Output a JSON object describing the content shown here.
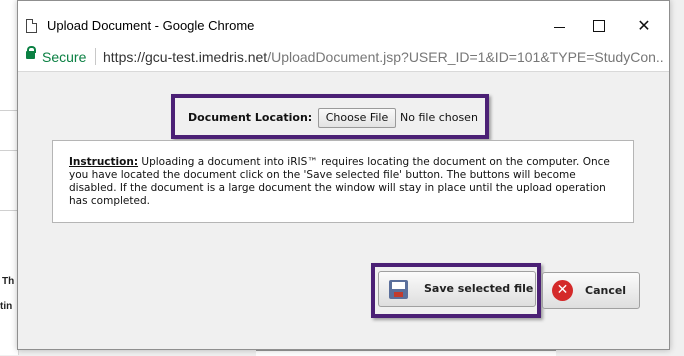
{
  "background": {
    "fragment_1": "Th",
    "fragment_2": "tin"
  },
  "window": {
    "title": "Upload Document - Google Chrome",
    "controls": {
      "minimize": "minimize",
      "maximize": "maximize",
      "close": "✕"
    }
  },
  "address_bar": {
    "secure_label": "Secure",
    "url_host": "https://gcu-test.imedris.net",
    "url_path": "/UploadDocument.jsp?USER_ID=1&ID=101&TYPE=StudyCon..."
  },
  "form": {
    "document_location_label": "Document Location:",
    "choose_file_label": "Choose File",
    "no_file_text": "No file chosen"
  },
  "instruction": {
    "heading": "Instruction:",
    "body": " Uploading a document into iRIS™ requires locating the document on the computer. Once you have located the document click on the 'Save selected file' button. The buttons will become disabled. If the document is a large document the window will stay in place until the upload operation has completed."
  },
  "buttons": {
    "save_label": "Save selected file",
    "cancel_label": "Cancel",
    "cancel_icon_glyph": "✕"
  },
  "colors": {
    "highlight": "#4b2075",
    "secure": "#0b8043",
    "cancel_icon": "#d42a2a"
  },
  "icons": [
    "document-icon",
    "lock-icon",
    "disk-icon",
    "cancel-icon"
  ]
}
